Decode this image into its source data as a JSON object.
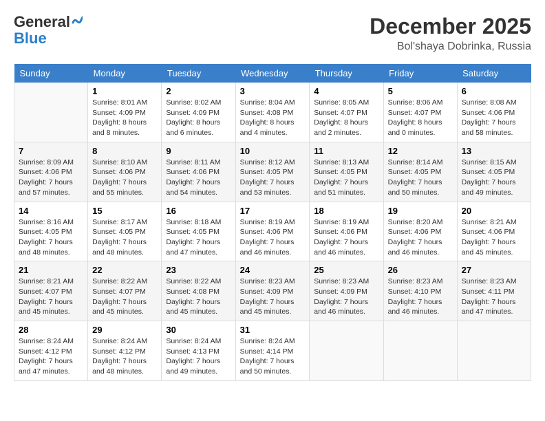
{
  "header": {
    "logo_line1": "General",
    "logo_line2": "Blue",
    "month": "December 2025",
    "location": "Bol'shaya Dobrinka, Russia"
  },
  "weekdays": [
    "Sunday",
    "Monday",
    "Tuesday",
    "Wednesday",
    "Thursday",
    "Friday",
    "Saturday"
  ],
  "weeks": [
    [
      {
        "day": "",
        "info": ""
      },
      {
        "day": "1",
        "info": "Sunrise: 8:01 AM\nSunset: 4:09 PM\nDaylight: 8 hours\nand 8 minutes."
      },
      {
        "day": "2",
        "info": "Sunrise: 8:02 AM\nSunset: 4:09 PM\nDaylight: 8 hours\nand 6 minutes."
      },
      {
        "day": "3",
        "info": "Sunrise: 8:04 AM\nSunset: 4:08 PM\nDaylight: 8 hours\nand 4 minutes."
      },
      {
        "day": "4",
        "info": "Sunrise: 8:05 AM\nSunset: 4:07 PM\nDaylight: 8 hours\nand 2 minutes."
      },
      {
        "day": "5",
        "info": "Sunrise: 8:06 AM\nSunset: 4:07 PM\nDaylight: 8 hours\nand 0 minutes."
      },
      {
        "day": "6",
        "info": "Sunrise: 8:08 AM\nSunset: 4:06 PM\nDaylight: 7 hours\nand 58 minutes."
      }
    ],
    [
      {
        "day": "7",
        "info": "Sunrise: 8:09 AM\nSunset: 4:06 PM\nDaylight: 7 hours\nand 57 minutes."
      },
      {
        "day": "8",
        "info": "Sunrise: 8:10 AM\nSunset: 4:06 PM\nDaylight: 7 hours\nand 55 minutes."
      },
      {
        "day": "9",
        "info": "Sunrise: 8:11 AM\nSunset: 4:06 PM\nDaylight: 7 hours\nand 54 minutes."
      },
      {
        "day": "10",
        "info": "Sunrise: 8:12 AM\nSunset: 4:05 PM\nDaylight: 7 hours\nand 53 minutes."
      },
      {
        "day": "11",
        "info": "Sunrise: 8:13 AM\nSunset: 4:05 PM\nDaylight: 7 hours\nand 51 minutes."
      },
      {
        "day": "12",
        "info": "Sunrise: 8:14 AM\nSunset: 4:05 PM\nDaylight: 7 hours\nand 50 minutes."
      },
      {
        "day": "13",
        "info": "Sunrise: 8:15 AM\nSunset: 4:05 PM\nDaylight: 7 hours\nand 49 minutes."
      }
    ],
    [
      {
        "day": "14",
        "info": "Sunrise: 8:16 AM\nSunset: 4:05 PM\nDaylight: 7 hours\nand 48 minutes."
      },
      {
        "day": "15",
        "info": "Sunrise: 8:17 AM\nSunset: 4:05 PM\nDaylight: 7 hours\nand 48 minutes."
      },
      {
        "day": "16",
        "info": "Sunrise: 8:18 AM\nSunset: 4:05 PM\nDaylight: 7 hours\nand 47 minutes."
      },
      {
        "day": "17",
        "info": "Sunrise: 8:19 AM\nSunset: 4:06 PM\nDaylight: 7 hours\nand 46 minutes."
      },
      {
        "day": "18",
        "info": "Sunrise: 8:19 AM\nSunset: 4:06 PM\nDaylight: 7 hours\nand 46 minutes."
      },
      {
        "day": "19",
        "info": "Sunrise: 8:20 AM\nSunset: 4:06 PM\nDaylight: 7 hours\nand 46 minutes."
      },
      {
        "day": "20",
        "info": "Sunrise: 8:21 AM\nSunset: 4:06 PM\nDaylight: 7 hours\nand 45 minutes."
      }
    ],
    [
      {
        "day": "21",
        "info": "Sunrise: 8:21 AM\nSunset: 4:07 PM\nDaylight: 7 hours\nand 45 minutes."
      },
      {
        "day": "22",
        "info": "Sunrise: 8:22 AM\nSunset: 4:07 PM\nDaylight: 7 hours\nand 45 minutes."
      },
      {
        "day": "23",
        "info": "Sunrise: 8:22 AM\nSunset: 4:08 PM\nDaylight: 7 hours\nand 45 minutes."
      },
      {
        "day": "24",
        "info": "Sunrise: 8:23 AM\nSunset: 4:09 PM\nDaylight: 7 hours\nand 45 minutes."
      },
      {
        "day": "25",
        "info": "Sunrise: 8:23 AM\nSunset: 4:09 PM\nDaylight: 7 hours\nand 46 minutes."
      },
      {
        "day": "26",
        "info": "Sunrise: 8:23 AM\nSunset: 4:10 PM\nDaylight: 7 hours\nand 46 minutes."
      },
      {
        "day": "27",
        "info": "Sunrise: 8:23 AM\nSunset: 4:11 PM\nDaylight: 7 hours\nand 47 minutes."
      }
    ],
    [
      {
        "day": "28",
        "info": "Sunrise: 8:24 AM\nSunset: 4:12 PM\nDaylight: 7 hours\nand 47 minutes."
      },
      {
        "day": "29",
        "info": "Sunrise: 8:24 AM\nSunset: 4:12 PM\nDaylight: 7 hours\nand 48 minutes."
      },
      {
        "day": "30",
        "info": "Sunrise: 8:24 AM\nSunset: 4:13 PM\nDaylight: 7 hours\nand 49 minutes."
      },
      {
        "day": "31",
        "info": "Sunrise: 8:24 AM\nSunset: 4:14 PM\nDaylight: 7 hours\nand 50 minutes."
      },
      {
        "day": "",
        "info": ""
      },
      {
        "day": "",
        "info": ""
      },
      {
        "day": "",
        "info": ""
      }
    ]
  ]
}
